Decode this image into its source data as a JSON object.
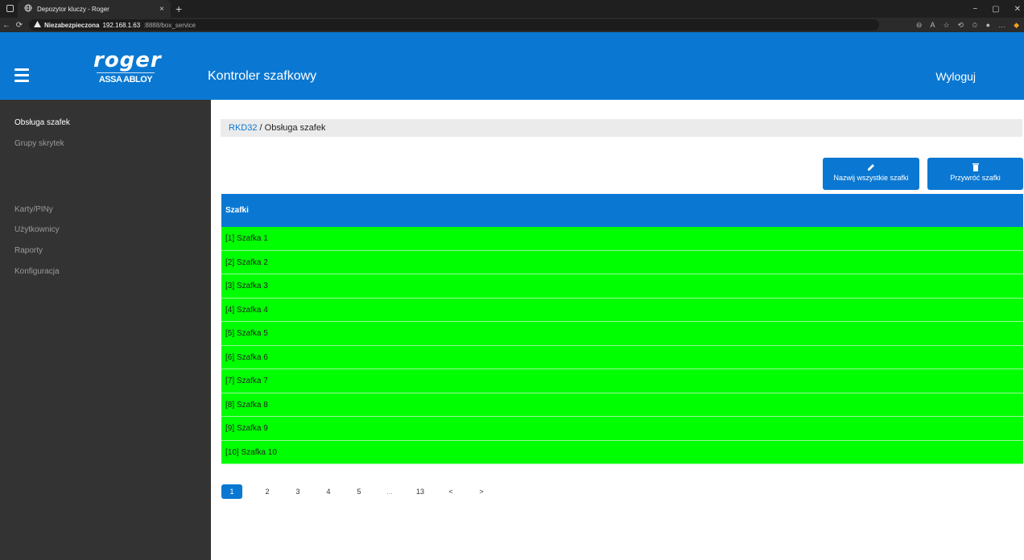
{
  "browser": {
    "tab_title": "Depozytor kluczy - Roger",
    "tab_close": "×",
    "new_tab": "+",
    "security_label": "Niezabezpieczona",
    "url_host": "192.168.1.63",
    "url_rest": ":8888/box_service",
    "more": "…",
    "minimize": "−",
    "restore": "▢",
    "close": "✕"
  },
  "header": {
    "logo_text": "roger",
    "logo_sub": "ASSA ABLOY",
    "title": "Kontroler szafkowy",
    "logout": "Wyloguj"
  },
  "sidebar": {
    "items": [
      {
        "label": "Obsługa szafek",
        "active": true
      },
      {
        "label": "Grupy skrytek",
        "active": false
      },
      {
        "label": "Karty/PINy",
        "active": false
      },
      {
        "label": "Użytkownicy",
        "active": false
      },
      {
        "label": "Raporty",
        "active": false
      },
      {
        "label": "Konfiguracja",
        "active": false
      }
    ]
  },
  "breadcrumb": {
    "link": "RKD32",
    "separator": " / ",
    "current": "Obsługa szafek"
  },
  "actions": {
    "rename_all": "Nazwij wszystkie szafki",
    "restore": "Przywróć szafki"
  },
  "table": {
    "header": "Szafki",
    "rows": [
      "[1] Szafka 1",
      "[2] Szafka 2",
      "[3] Szafka 3",
      "[4] Szafka 4",
      "[5] Szafka 5",
      "[6] Szafka 6",
      "[7] Szafka 7",
      "[8] Szafka 8",
      "[9] Szafka 9",
      "[10] Szafka 10"
    ]
  },
  "pagination": {
    "pages": [
      "1",
      "2",
      "3",
      "4",
      "5",
      "...",
      "13",
      "<",
      ">"
    ],
    "current": "1"
  },
  "colors": {
    "primary": "#0a78d2",
    "row_available": "#00ff00",
    "sidebar_bg": "#333333"
  }
}
